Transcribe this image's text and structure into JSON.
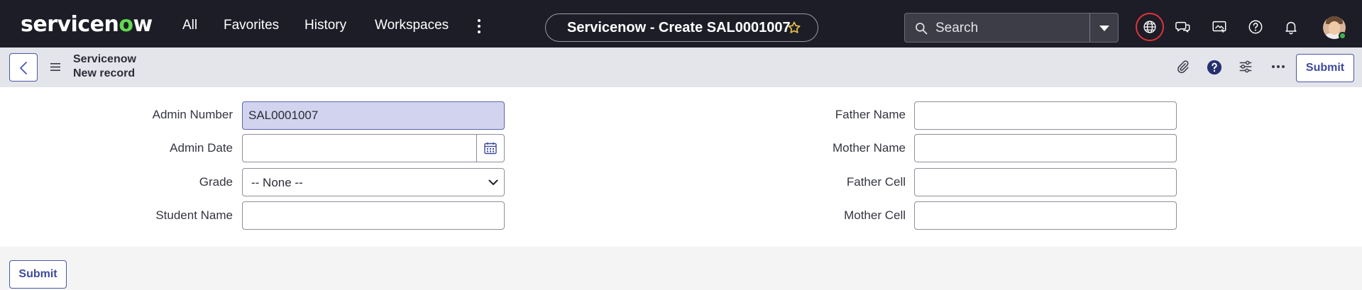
{
  "topbar": {
    "logo": {
      "part1": "servicen",
      "part2": "o",
      "part3": "w"
    },
    "nav": [
      {
        "label": "All"
      },
      {
        "label": "Favorites"
      },
      {
        "label": "History"
      },
      {
        "label": "Workspaces"
      }
    ],
    "more_icon": "more-vertical-icon",
    "page_title": "Servicenow - Create SAL0001007",
    "favorite_icon": "star-icon",
    "search": {
      "placeholder": "Search",
      "icon": "search-icon",
      "scope_icon": "caret-down-icon"
    },
    "icons": [
      "globe-icon",
      "chat-icon",
      "screen-share-icon",
      "help-icon",
      "bell-icon"
    ],
    "brand_color": "#62d84e",
    "accent_color": "#e0333a"
  },
  "subheader": {
    "back_icon": "chevron-left-icon",
    "menu_icon": "hamburger-icon",
    "table_name": "Servicenow",
    "record_label": "New record",
    "icons": [
      "paperclip-icon",
      "question-icon",
      "sliders-icon",
      "more-horizontal-icon"
    ],
    "submit_label": "Submit"
  },
  "form": {
    "left": [
      {
        "label": "Admin Number",
        "value": "SAL0001007"
      },
      {
        "label": "Admin Date",
        "value": ""
      },
      {
        "label": "Grade",
        "value": "-- None --"
      },
      {
        "label": "Student Name",
        "value": ""
      }
    ],
    "right": [
      {
        "label": "Father Name",
        "value": ""
      },
      {
        "label": "Mother Name",
        "value": ""
      },
      {
        "label": "Father Cell",
        "value": ""
      },
      {
        "label": "Mother Cell",
        "value": ""
      }
    ],
    "calendar_icon": "calendar-icon",
    "submit_label": "Submit"
  }
}
